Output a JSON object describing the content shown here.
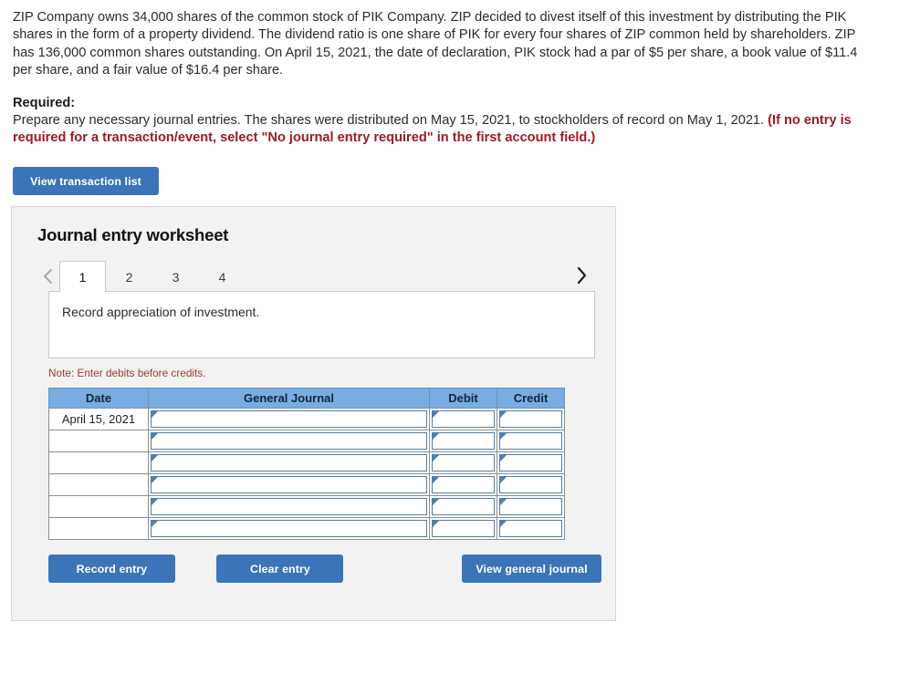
{
  "problem": {
    "text": "ZIP Company owns 34,000 shares of the common stock of PIK Company. ZIP decided to divest itself of this investment by distributing the PIK shares in the form of a property dividend. The dividend ratio is one share of PIK for every four shares of ZIP common held by shareholders. ZIP has 136,000 common shares outstanding. On April 15, 2021, the date of declaration, PIK stock had a par of $5 per share, a book value of $11.4 per share, and a fair value of $16.4 per share."
  },
  "required": {
    "label": "Required:",
    "text": "Prepare any necessary journal entries. The shares were distributed on May 15, 2021, to stockholders of record on May 1, 2021. ",
    "red_text": "(If no entry is required for a transaction/event, select \"No journal entry required\" in the first account field.)",
    "red_color": "#9c1b26"
  },
  "toolbar": {
    "view_transaction_list_label": "View transaction list"
  },
  "worksheet": {
    "title": "Journal entry worksheet",
    "prev_arrow": "‹",
    "next_arrow": "›",
    "tabs": [
      {
        "label": "1",
        "active": true
      },
      {
        "label": "2",
        "active": false
      },
      {
        "label": "3",
        "active": false
      },
      {
        "label": "4",
        "active": false
      }
    ],
    "description": "Record appreciation of investment.",
    "note": "Note: Enter debits before credits.",
    "accent_header_color": "#79ace0",
    "button_color": "#3b75b8",
    "table": {
      "headers": [
        "Date",
        "General Journal",
        "Debit",
        "Credit"
      ],
      "rows": [
        {
          "date": "April 15, 2021",
          "general_journal": "",
          "debit": "",
          "credit": ""
        },
        {
          "date": "",
          "general_journal": "",
          "debit": "",
          "credit": ""
        },
        {
          "date": "",
          "general_journal": "",
          "debit": "",
          "credit": ""
        },
        {
          "date": "",
          "general_journal": "",
          "debit": "",
          "credit": ""
        },
        {
          "date": "",
          "general_journal": "",
          "debit": "",
          "credit": ""
        },
        {
          "date": "",
          "general_journal": "",
          "debit": "",
          "credit": ""
        }
      ]
    },
    "footer": {
      "record_entry_label": "Record entry",
      "clear_entry_label": "Clear entry",
      "view_general_journal_label": "View general journal"
    }
  }
}
